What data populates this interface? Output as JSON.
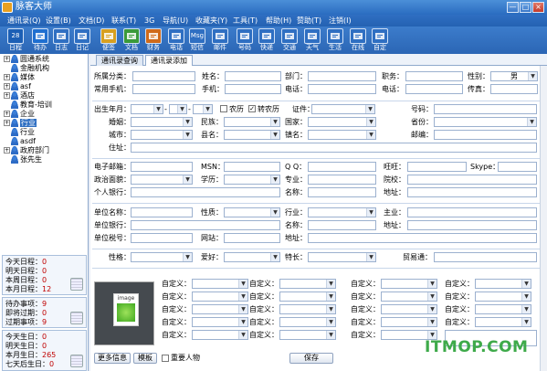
{
  "window": {
    "title": "脉客大师",
    "min": "—",
    "max": "□",
    "close": "×"
  },
  "menu": [
    "通讯录(Q)",
    "设置(B)",
    "文档(D)",
    "联系(T)",
    "3G",
    "导航(U)",
    "收藏夹(Y)",
    "工具(T)",
    "帮助(H)",
    "赞助(T)",
    "注销(I)"
  ],
  "toolbar": [
    {
      "label": "日程",
      "icon": "calendar-icon",
      "color": "#1c5fb5",
      "glyph": "28"
    },
    {
      "label": "待办",
      "icon": "check-icon",
      "color": "#1f6fd0"
    },
    {
      "label": "日志",
      "icon": "log-icon",
      "color": "#2f6fc2"
    },
    {
      "label": "日记",
      "icon": "diary-icon",
      "color": "#2f6fc2"
    },
    {
      "label": "便签",
      "icon": "note-icon",
      "color": "#d8a020"
    },
    {
      "label": "文档",
      "icon": "folder-icon",
      "color": "#3a9a3a"
    },
    {
      "label": "财务",
      "icon": "finance-icon",
      "color": "#d06a1a"
    },
    {
      "label": "电话",
      "icon": "phone-icon",
      "color": "#2f6fc2"
    },
    {
      "label": "短信",
      "icon": "sms-icon",
      "color": "#2f6fc2",
      "glyph": "Msg"
    },
    {
      "label": "邮件",
      "icon": "mail-icon",
      "color": "#2f6fc2"
    },
    {
      "label": "号码",
      "icon": "number-icon",
      "color": "#2f6fc2"
    },
    {
      "label": "快递",
      "icon": "express-icon",
      "color": "#2f6fc2"
    },
    {
      "label": "交通",
      "icon": "plane-icon",
      "color": "#2f6fc2"
    },
    {
      "label": "天气",
      "icon": "weather-icon",
      "color": "#2f6fc2"
    },
    {
      "label": "生活",
      "icon": "ie-icon",
      "color": "#2f6fc2"
    },
    {
      "label": "在线",
      "icon": "ie-icon",
      "color": "#2f6fc2"
    },
    {
      "label": "自定",
      "icon": "ie-icon",
      "color": "#2f6fc2"
    }
  ],
  "tree": [
    {
      "label": "圆通系统",
      "exp": "+"
    },
    {
      "label": "金融机构",
      "exp": ""
    },
    {
      "label": "媒体",
      "exp": "+"
    },
    {
      "label": "asf",
      "exp": "+"
    },
    {
      "label": "酒店",
      "exp": "+"
    },
    {
      "label": "教育-培训",
      "exp": ""
    },
    {
      "label": "企业",
      "exp": "+"
    },
    {
      "label": "行业",
      "exp": "+",
      "selected": true
    },
    {
      "label": "行业",
      "exp": ""
    },
    {
      "label": "asdf",
      "exp": ""
    },
    {
      "label": "政府部门",
      "exp": "+"
    },
    {
      "label": "张先生",
      "exp": ""
    }
  ],
  "schedule": [
    {
      "label": "今天日程：",
      "value": "0"
    },
    {
      "label": "明天日程：",
      "value": "0"
    },
    {
      "label": "本周日程：",
      "value": "0"
    },
    {
      "label": "本月日程：",
      "value": "12"
    }
  ],
  "todo": [
    {
      "label": "待办事项：",
      "value": "9"
    },
    {
      "label": "即将过期：",
      "value": "0"
    },
    {
      "label": "过期事项：",
      "value": "9"
    }
  ],
  "birthday": [
    {
      "label": "今天生日：",
      "value": "0"
    },
    {
      "label": "明天生日：",
      "value": "0"
    },
    {
      "label": "本月生日：",
      "value": "265"
    },
    {
      "label": "七天后生日：",
      "value": "0"
    }
  ],
  "tabs": [
    "通讯录查询",
    "通讯录添加"
  ],
  "form": {
    "group": "所属分类：",
    "name": "姓名：",
    "dept": "部门：",
    "job": "职务：",
    "gender": "性别：",
    "gender_val": "男",
    "mobile": "常用手机：",
    "phone2": "手机：",
    "tel": "电话：",
    "tel2": "电话：",
    "fax": "传真：",
    "birth": "出生年月：",
    "nongli": "农历",
    "zhuan": "转农历",
    "id": "证件：",
    "idno": "号码：",
    "marriage": "婚姻：",
    "nation": "民族：",
    "country": "国家：",
    "province": "省份：",
    "city": "城市：",
    "county": "县名：",
    "town": "镇名：",
    "zip": "邮编：",
    "addr": "住址：",
    "email": "电子邮箱：",
    "msn": "MSN：",
    "qq": "Q Q：",
    "ww": "旺旺：",
    "skype": "Skype：",
    "politic": "政治面貌：",
    "edu": "学历：",
    "major": "专业：",
    "school": "院校：",
    "bank": "个人银行：",
    "acct": "名称：",
    "bankaddr": "地址：",
    "company": "单位名称：",
    "nature": "性质：",
    "industry": "行业：",
    "biz": "主业：",
    "cbank": "单位银行：",
    "cacct": "名称：",
    "caddr": "地址：",
    "tax": "单位税号：",
    "web": "网站：",
    "cpaddr": "地址：",
    "character": "性格：",
    "hobby": "爱好：",
    "skill": "特长：",
    "trade": "贸易通：",
    "custom": "自定义：",
    "photo": "image",
    "more": "更多信息",
    "template": "模板",
    "important": "重要人物",
    "save": "保存"
  },
  "watermark": {
    "text1": "ITMOP",
    "dot": ".",
    "text2": "COM"
  }
}
